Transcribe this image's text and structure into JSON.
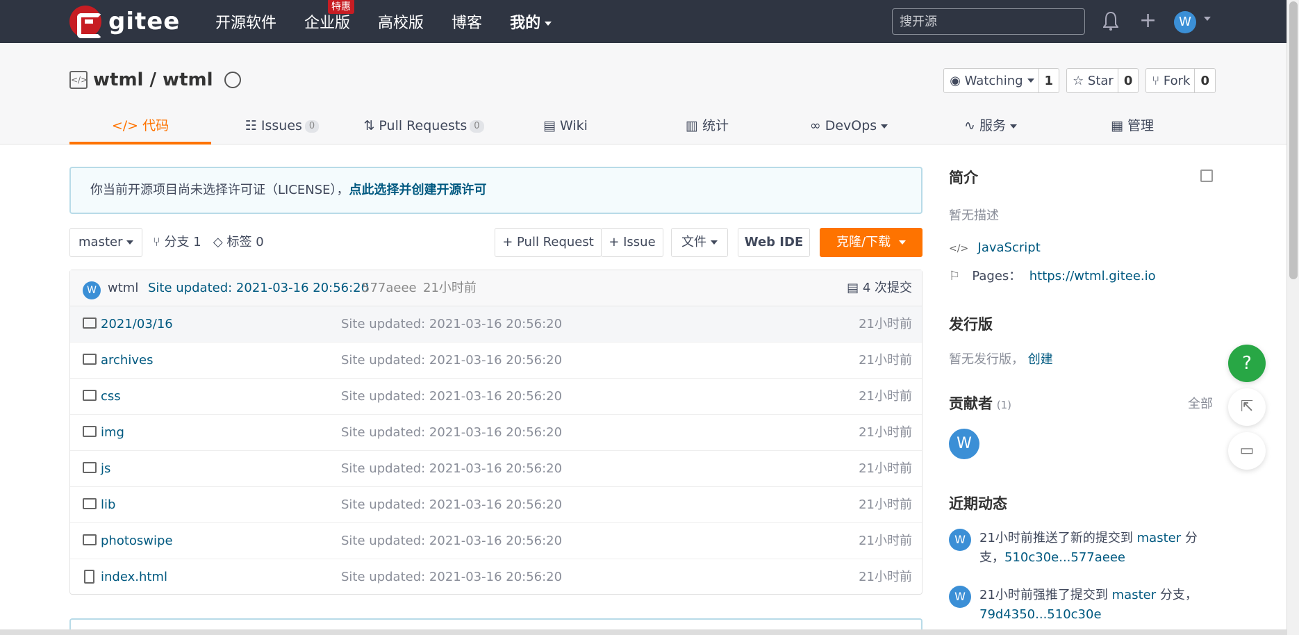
{
  "nav": {
    "logo_text": "gitee",
    "items": [
      "开源软件",
      "企业版",
      "高校版",
      "博客",
      "我的"
    ],
    "enterprise_badge": "特惠",
    "search_placeholder": "搜开源",
    "avatar": "W"
  },
  "repo": {
    "name": "wtml / wtml",
    "watch_label": "Watching",
    "watch_count": "1",
    "star_label": "Star",
    "star_count": "0",
    "fork_label": "Fork",
    "fork_count": "0",
    "tabs": [
      {
        "label": "代码"
      },
      {
        "label": "Issues",
        "count": "0"
      },
      {
        "label": "Pull Requests",
        "count": "0"
      },
      {
        "label": "Wiki"
      },
      {
        "label": "统计"
      },
      {
        "label": "DevOps"
      },
      {
        "label": "服务"
      },
      {
        "label": "管理"
      }
    ]
  },
  "license": {
    "text": "你当前开源项目尚未选择许可证（LICENSE），",
    "link": "点此选择并创建开源许可"
  },
  "toolbar": {
    "branch": "master",
    "branches": "分支 1",
    "tags": "标签 0",
    "pull_request": "+ Pull Request",
    "issue": "+ Issue",
    "file": "文件",
    "web_ide": "Web IDE",
    "clone": "克隆/下载"
  },
  "commit": {
    "avatar": "W",
    "user": "wtml",
    "message": "Site updated: 2021-03-16 20:56:20",
    "hash": "577aeee",
    "time": "21小时前",
    "count": "4 次提交"
  },
  "files": [
    {
      "name": "2021/03/16",
      "message": "Site updated: 2021-03-16 20:56:20",
      "time": "21小时前",
      "type": "folder"
    },
    {
      "name": "archives",
      "message": "Site updated: 2021-03-16 20:56:20",
      "time": "21小时前",
      "type": "folder"
    },
    {
      "name": "css",
      "message": "Site updated: 2021-03-16 20:56:20",
      "time": "21小时前",
      "type": "folder"
    },
    {
      "name": "img",
      "message": "Site updated: 2021-03-16 20:56:20",
      "time": "21小时前",
      "type": "folder"
    },
    {
      "name": "js",
      "message": "Site updated: 2021-03-16 20:56:20",
      "time": "21小时前",
      "type": "folder"
    },
    {
      "name": "lib",
      "message": "Site updated: 2021-03-16 20:56:20",
      "time": "21小时前",
      "type": "folder"
    },
    {
      "name": "photoswipe",
      "message": "Site updated: 2021-03-16 20:56:20",
      "time": "21小时前",
      "type": "folder"
    },
    {
      "name": "index.html",
      "message": "Site updated: 2021-03-16 20:56:20",
      "time": "21小时前",
      "type": "file"
    }
  ],
  "sidebar": {
    "intro_title": "简介",
    "intro_desc": "暂无描述",
    "language": "JavaScript",
    "pages_label": "Pages：",
    "pages_url": "https://wtml.gitee.io",
    "release_title": "发行版",
    "release_text": "暂无发行版，",
    "release_link": "创建",
    "contrib_title": "贡献者",
    "contrib_count": "(1)",
    "contrib_all": "全部",
    "contrib_avatar": "W",
    "activity_title": "近期动态",
    "activities": [
      {
        "avatar": "W",
        "prefix": "21小时前推送了新的提交到 ",
        "branch": "master",
        "suffix": " 分支，",
        "range": "510c30e...577aeee"
      },
      {
        "avatar": "W",
        "prefix": "21小时前强推了提交到 ",
        "branch": "master",
        "suffix": " 分支，",
        "range": "79d4350...510c30e"
      }
    ]
  },
  "fab": {
    "help": "?"
  }
}
